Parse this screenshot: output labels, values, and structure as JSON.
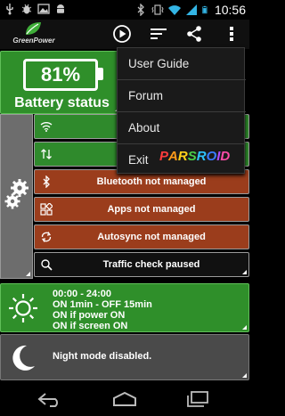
{
  "status_bar": {
    "time": "10:56",
    "left_icons": [
      "usb-icon",
      "bug-icon",
      "image-icon",
      "android-icon"
    ],
    "right_icons": [
      "bluetooth-icon",
      "vibrate-icon",
      "wifi-icon",
      "signal-icon",
      "battery-icon"
    ]
  },
  "action_bar": {
    "app_name": "GreenPower",
    "buttons": [
      "play-icon",
      "sort-icon",
      "share-icon",
      "overflow-icon"
    ]
  },
  "battery": {
    "percent": "81%",
    "label": "Battery status",
    "level": 0.81
  },
  "toggles": [
    {
      "icon": "wifi-icon",
      "label": "Wi-Fi",
      "state_color": "#2f8a2c"
    },
    {
      "icon": "data-icon",
      "label": "Data",
      "state_color": "#2f8a2c"
    },
    {
      "icon": "bluetooth-icon",
      "label": "Bluetooth not managed",
      "state_color": "#9b3d1c"
    },
    {
      "icon": "apps-icon",
      "label": "Apps not managed",
      "state_color": "#9b3d1c"
    },
    {
      "icon": "sync-icon",
      "label": "Autosync not managed",
      "state_color": "#9b3d1c"
    },
    {
      "icon": "search-icon",
      "label": "Traffic check paused",
      "state_color": "#111111"
    }
  ],
  "schedule": {
    "lines": [
      "00:00 - 24:00",
      "ON 1min - OFF 15min",
      "ON if power ON",
      "ON if screen ON"
    ]
  },
  "night_mode": {
    "text": "Night mode disabled."
  },
  "menu": {
    "items": [
      "User Guide",
      "Forum",
      "About",
      "Exit"
    ],
    "watermark": "PARSROID",
    "watermark_colors": [
      "#ff3c3c",
      "#ff9a1a",
      "#ffd21a",
      "#4ad04a",
      "#2ec4ff",
      "#3a7bff",
      "#b04cff",
      "#ff4ca8"
    ]
  },
  "nav_bar": {
    "buttons": [
      "back-icon",
      "home-icon",
      "recents-icon"
    ]
  }
}
